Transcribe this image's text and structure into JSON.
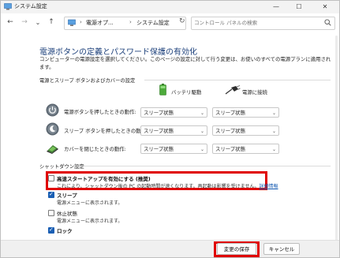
{
  "window": {
    "title": "システム設定",
    "controls": {
      "minimize": "—",
      "maximize": "☐",
      "close": "✕"
    }
  },
  "address_bar": {
    "nav": {
      "back": "←",
      "forward": "→",
      "recent": "⌄",
      "up": "↑"
    },
    "breadcrumb": [
      "電源オプ...",
      "システム設定"
    ],
    "separator": "›",
    "refresh": "↻",
    "search_placeholder": "コントロール パネルの検索"
  },
  "page": {
    "title": "電源ボタンの定義とパスワード保護の有効化",
    "description": "コンピューターの電源設定を選択してください。このページの設定に対して行う変更は、お使いのすべての電源プランに適用されます。"
  },
  "power_buttons": {
    "section_title": "電源とスリープ ボタンおよびカバーの設定",
    "columns": {
      "battery": "バッテリ駆動",
      "plugged_in": "電源に接続"
    },
    "rows": [
      {
        "label": "電源ボタンを押したときの動作:",
        "battery": "スリープ状態",
        "plugged_in": "スリープ状態"
      },
      {
        "label": "スリープ ボタンを押したときの動作:",
        "battery": "スリープ状態",
        "plugged_in": "スリープ状態"
      },
      {
        "label": "カバーを閉じたときの動作:",
        "battery": "スリープ状態",
        "plugged_in": "スリープ状態"
      }
    ]
  },
  "shutdown": {
    "section_title": "シャットダウン設定",
    "options": [
      {
        "label": "高速スタートアップを有効にする (推奨)",
        "checked": false,
        "description": "これにより、シャットダウン後の PC の起動時間が速くなります。再起動は影響を受けません。",
        "link": "詳細情報"
      },
      {
        "label": "スリープ",
        "checked": true,
        "description": "電源メニューに表示されます。"
      },
      {
        "label": "休止状態",
        "checked": false,
        "description": "電源メニューに表示されます。"
      },
      {
        "label": "ロック",
        "checked": true,
        "description": ""
      }
    ]
  },
  "footer": {
    "save": "変更の保存",
    "cancel": "キャンセル"
  },
  "colors": {
    "highlight": "#e00000",
    "title_blue": "#1b3f7a",
    "check_blue": "#1a5fb4"
  }
}
